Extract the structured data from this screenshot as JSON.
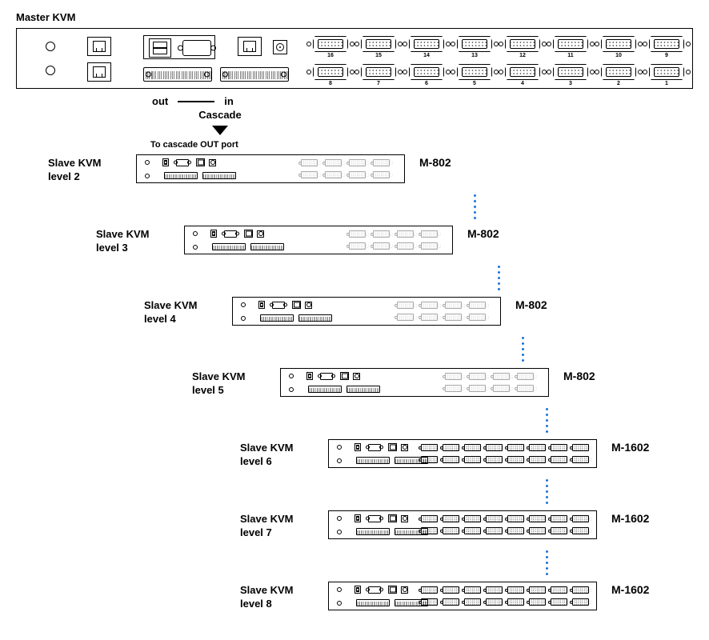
{
  "title": "Master KVM",
  "legend": {
    "out": "out",
    "in": "in",
    "cascade": "Cascade"
  },
  "cascade_note": "To cascade OUT port",
  "master_ports_top": [
    "16",
    "15",
    "14",
    "13",
    "12",
    "11",
    "10",
    "9"
  ],
  "master_ports_bottom": [
    "8",
    "7",
    "6",
    "5",
    "4",
    "3",
    "2",
    "1"
  ],
  "slaves": [
    {
      "label_top": "Slave KVM",
      "label_bottom": "level 2",
      "model": "M-802",
      "port_count": 8
    },
    {
      "label_top": "Slave KVM",
      "label_bottom": "level 3",
      "model": "M-802",
      "port_count": 8
    },
    {
      "label_top": "Slave KVM",
      "label_bottom": "level 4",
      "model": "M-802",
      "port_count": 8
    },
    {
      "label_top": "Slave KVM",
      "label_bottom": "level 5",
      "model": "M-802",
      "port_count": 8
    },
    {
      "label_top": "Slave KVM",
      "label_bottom": "level 6",
      "model": "M-1602",
      "port_count": 16
    },
    {
      "label_top": "Slave KVM",
      "label_bottom": "level 7",
      "model": "M-1602",
      "port_count": 16
    },
    {
      "label_top": "Slave KVM",
      "label_bottom": "level 8",
      "model": "M-1602",
      "port_count": 16
    }
  ]
}
